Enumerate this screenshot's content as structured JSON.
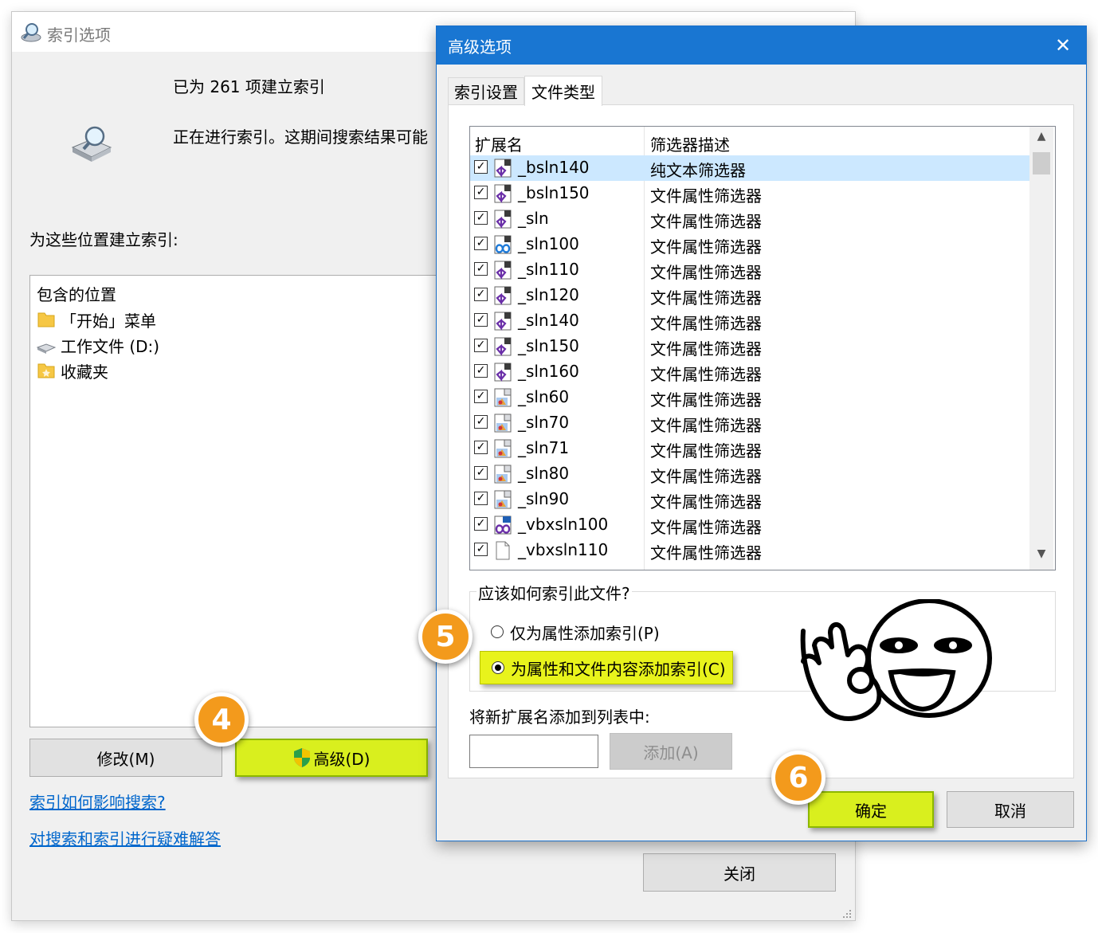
{
  "background_window": {
    "title": "索引选项",
    "indexed_count": "已为 261 项建立索引",
    "indexing_status": "正在进行索引。这期间搜索结果可能",
    "locations_heading": "为这些位置建立索引:",
    "included_header": "包含的位置",
    "locations": [
      {
        "icon": "start-menu-folder-icon",
        "label": "「开始」菜单"
      },
      {
        "icon": "drive-icon",
        "label": "工作文件 (D:)"
      },
      {
        "icon": "favorites-folder-icon",
        "label": "收藏夹"
      }
    ],
    "modify_button": "修改(M)",
    "advanced_button": "高级(D)",
    "link_how_affects": "索引如何影响搜索?",
    "link_troubleshoot": "对搜索和索引进行疑难解答",
    "close_button": "关闭"
  },
  "dialog": {
    "title": "高级选项",
    "tabs": [
      "索引设置",
      "文件类型"
    ],
    "active_tab": "文件类型",
    "columns": [
      "扩展名",
      "筛选器描述"
    ],
    "file_types": [
      {
        "ext": "_bsln140",
        "desc": "纯文本筛选器",
        "checked": true,
        "selected": true,
        "icon": "vs-solution-icon"
      },
      {
        "ext": "_bsln150",
        "desc": "文件属性筛选器",
        "checked": true,
        "icon": "vs-solution-icon"
      },
      {
        "ext": "_sln",
        "desc": "文件属性筛选器",
        "checked": true,
        "icon": "vs-solution-icon"
      },
      {
        "ext": "_sln100",
        "desc": "文件属性筛选器",
        "checked": true,
        "icon": "vs-infinity-icon"
      },
      {
        "ext": "_sln110",
        "desc": "文件属性筛选器",
        "checked": true,
        "icon": "vs-solution-icon"
      },
      {
        "ext": "_sln120",
        "desc": "文件属性筛选器",
        "checked": true,
        "icon": "vs-solution-icon"
      },
      {
        "ext": "_sln140",
        "desc": "文件属性筛选器",
        "checked": true,
        "icon": "vs-solution-icon"
      },
      {
        "ext": "_sln150",
        "desc": "文件属性筛选器",
        "checked": true,
        "icon": "vs-solution-icon"
      },
      {
        "ext": "_sln160",
        "desc": "文件属性筛选器",
        "checked": true,
        "icon": "vs-solution-icon"
      },
      {
        "ext": "_sln60",
        "desc": "文件属性筛选器",
        "checked": true,
        "icon": "vs-legacy-icon"
      },
      {
        "ext": "_sln70",
        "desc": "文件属性筛选器",
        "checked": true,
        "icon": "vs-legacy-icon"
      },
      {
        "ext": "_sln71",
        "desc": "文件属性筛选器",
        "checked": true,
        "icon": "vs-legacy-icon"
      },
      {
        "ext": "_sln80",
        "desc": "文件属性筛选器",
        "checked": true,
        "icon": "vs-legacy-icon"
      },
      {
        "ext": "_sln90",
        "desc": "文件属性筛选器",
        "checked": true,
        "icon": "vs-legacy-icon"
      },
      {
        "ext": "_vbxsln100",
        "desc": "文件属性筛选器",
        "checked": true,
        "icon": "vb-solution-icon"
      },
      {
        "ext": "_vbxsln110",
        "desc": "文件属性筛选器",
        "checked": true,
        "icon": "blank-file-icon"
      }
    ],
    "how_to_index_legend": "应该如何索引此文件?",
    "radio_props_only": "仅为属性添加索引(P)",
    "radio_props_content": "为属性和文件内容添加索引(C)",
    "selected_radio": "为属性和文件内容添加索引(C)",
    "add_ext_label": "将新扩展名添加到列表中:",
    "add_ext_input_value": "",
    "add_button": "添加(A)",
    "ok_button": "确定",
    "cancel_button": "取消"
  },
  "annotations": {
    "step_4": "4",
    "step_5": "5",
    "step_6": "6",
    "highlight_color": "#d9ef1e",
    "badge_color": "#f39a1c"
  },
  "colors": {
    "dialog_titlebar": "#1976d2",
    "selected_row": "#cce8ff",
    "link": "#0066cc"
  }
}
